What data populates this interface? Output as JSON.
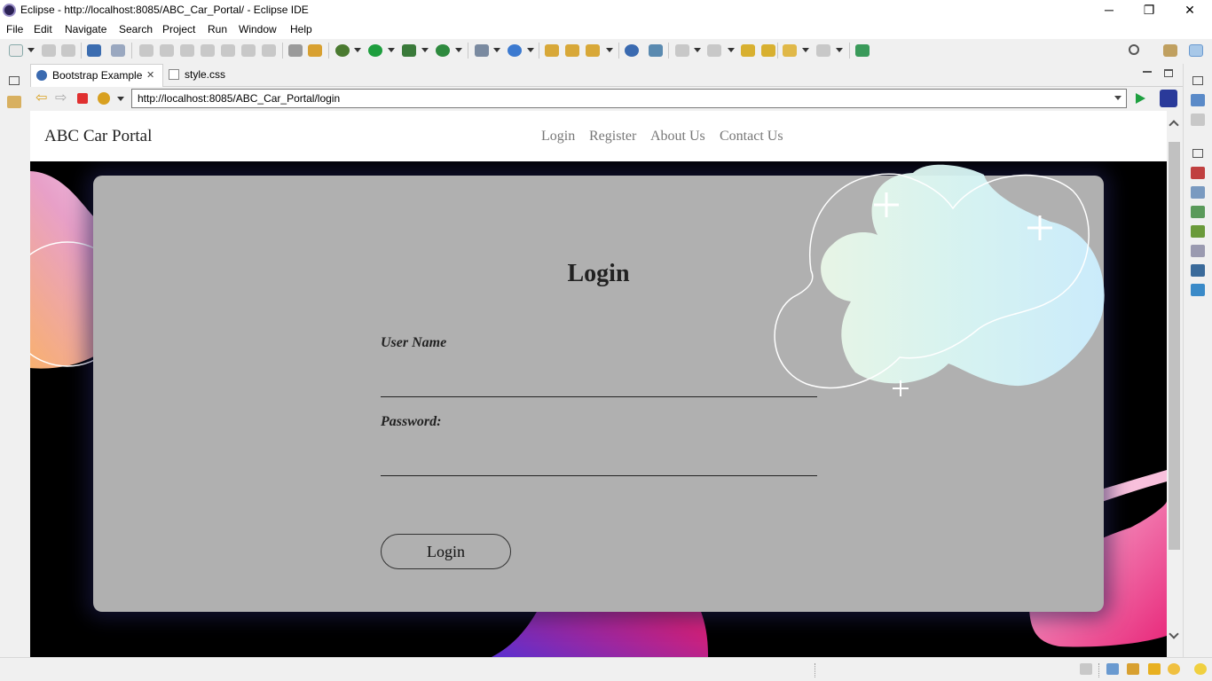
{
  "window": {
    "title": "Eclipse - http://localhost:8085/ABC_Car_Portal/ - Eclipse IDE",
    "minimize_glyph": "─",
    "restore_glyph": "❐",
    "close_glyph": "✕"
  },
  "menu": [
    "File",
    "Edit",
    "Navigate",
    "Search",
    "Project",
    "Run",
    "Window",
    "Help"
  ],
  "tabs": [
    {
      "label": "Bootstrap Example",
      "close_glyph": "✕"
    },
    {
      "label": "style.css"
    }
  ],
  "browser": {
    "url": "http://localhost:8085/ABC_Car_Portal/login"
  },
  "site": {
    "brand": "ABC Car Portal",
    "nav": [
      "Login",
      "Register",
      "About Us",
      "Contact Us"
    ]
  },
  "login_form": {
    "title": "Login",
    "username_label": "User Name",
    "password_label": "Password:",
    "submit_label": "Login"
  },
  "colors": {
    "card": "#b0b0b0",
    "page_background": "#000000",
    "navbar": "#ffffff"
  }
}
